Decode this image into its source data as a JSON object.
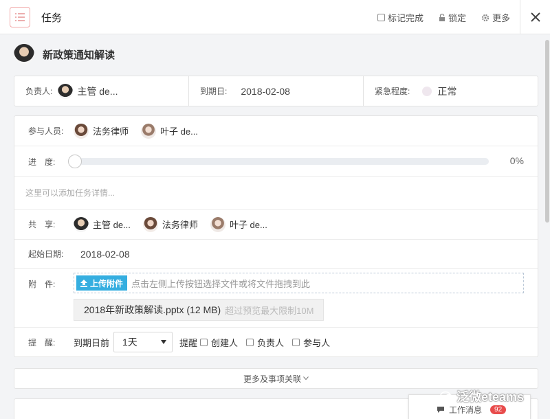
{
  "header": {
    "title": "任务",
    "mark_complete": "标记完成",
    "lock": "锁定",
    "more": "更多"
  },
  "task": {
    "title": "新政策通知解读"
  },
  "meta": {
    "owner_label": "负责人:",
    "owner_name": "主管 de...",
    "due_label": "到期日:",
    "due_value": "2018-02-08",
    "urgency_label": "紧急程度:",
    "urgency_value": "正常"
  },
  "detail": {
    "participants_label": "参与人员:",
    "participants": [
      "法务律师",
      "叶子 de..."
    ],
    "progress_label": "进　度:",
    "progress_percent": 0,
    "progress_text": "0%",
    "details_placeholder": "这里可以添加任务详情...",
    "share_label": "共　享:",
    "share_people": [
      "主管 de...",
      "法务律师",
      "叶子 de..."
    ],
    "start_label": "起始日期:",
    "start_value": "2018-02-08",
    "attach_label": "附　件:",
    "upload_button": "上传附件",
    "upload_tip": "点击左侧上传按钮选择文件或将文件拖拽到此",
    "file_name": "2018年新政策解读.pptx (12 MB)",
    "file_limit": "超过预览最大限制10M",
    "remind_label": "提　醒:",
    "remind_prefix": "到期日前",
    "remind_select": "1天",
    "remind_mid": "提醒",
    "remind_options": [
      "创建人",
      "负责人",
      "参与人"
    ]
  },
  "more_link": "更多及事项关联",
  "message": {
    "label": "工作消息",
    "count": "92"
  },
  "watermark": "泛微eteams",
  "colors": {
    "accent": "#35aee0",
    "badge": "#e84c4c",
    "menu_border": "#f2a9a9"
  }
}
